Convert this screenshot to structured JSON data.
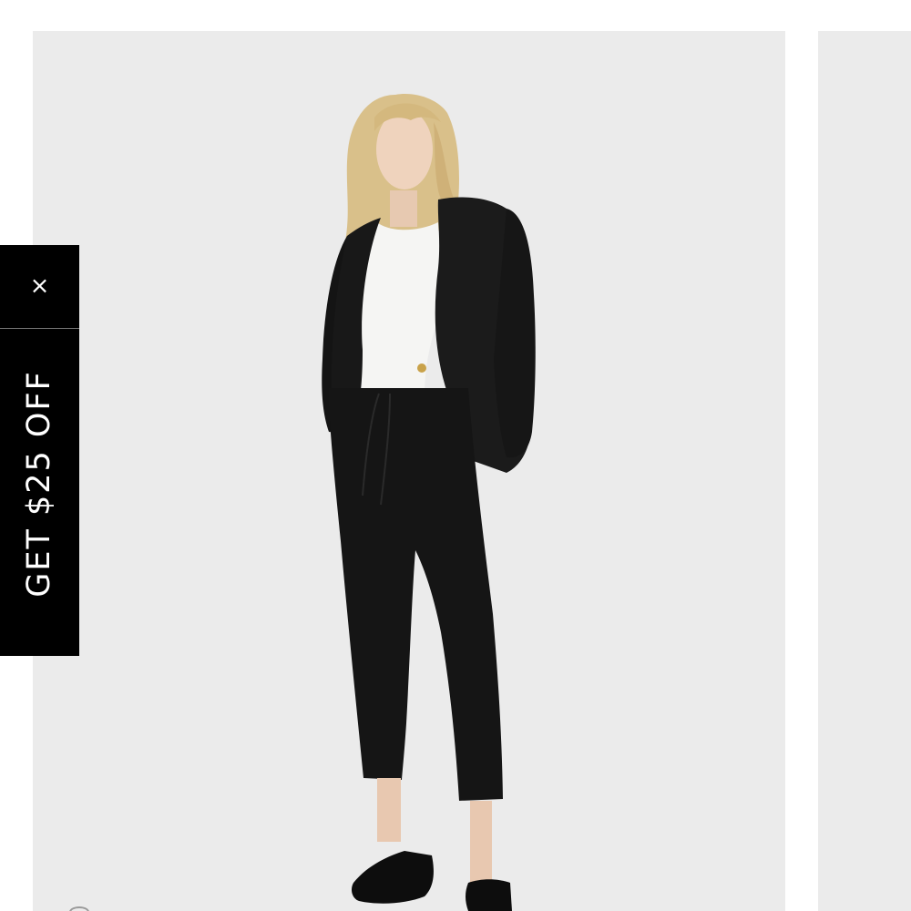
{
  "promo": {
    "close_glyph": "×",
    "label": "GET $25 OFF"
  },
  "product": {
    "image_icon": "product-photo-model-in-black-suit"
  },
  "colors": {
    "promo_background": "#000000",
    "promo_text": "#ffffff",
    "image_background": "#ebebeb",
    "page_background": "#ffffff"
  }
}
